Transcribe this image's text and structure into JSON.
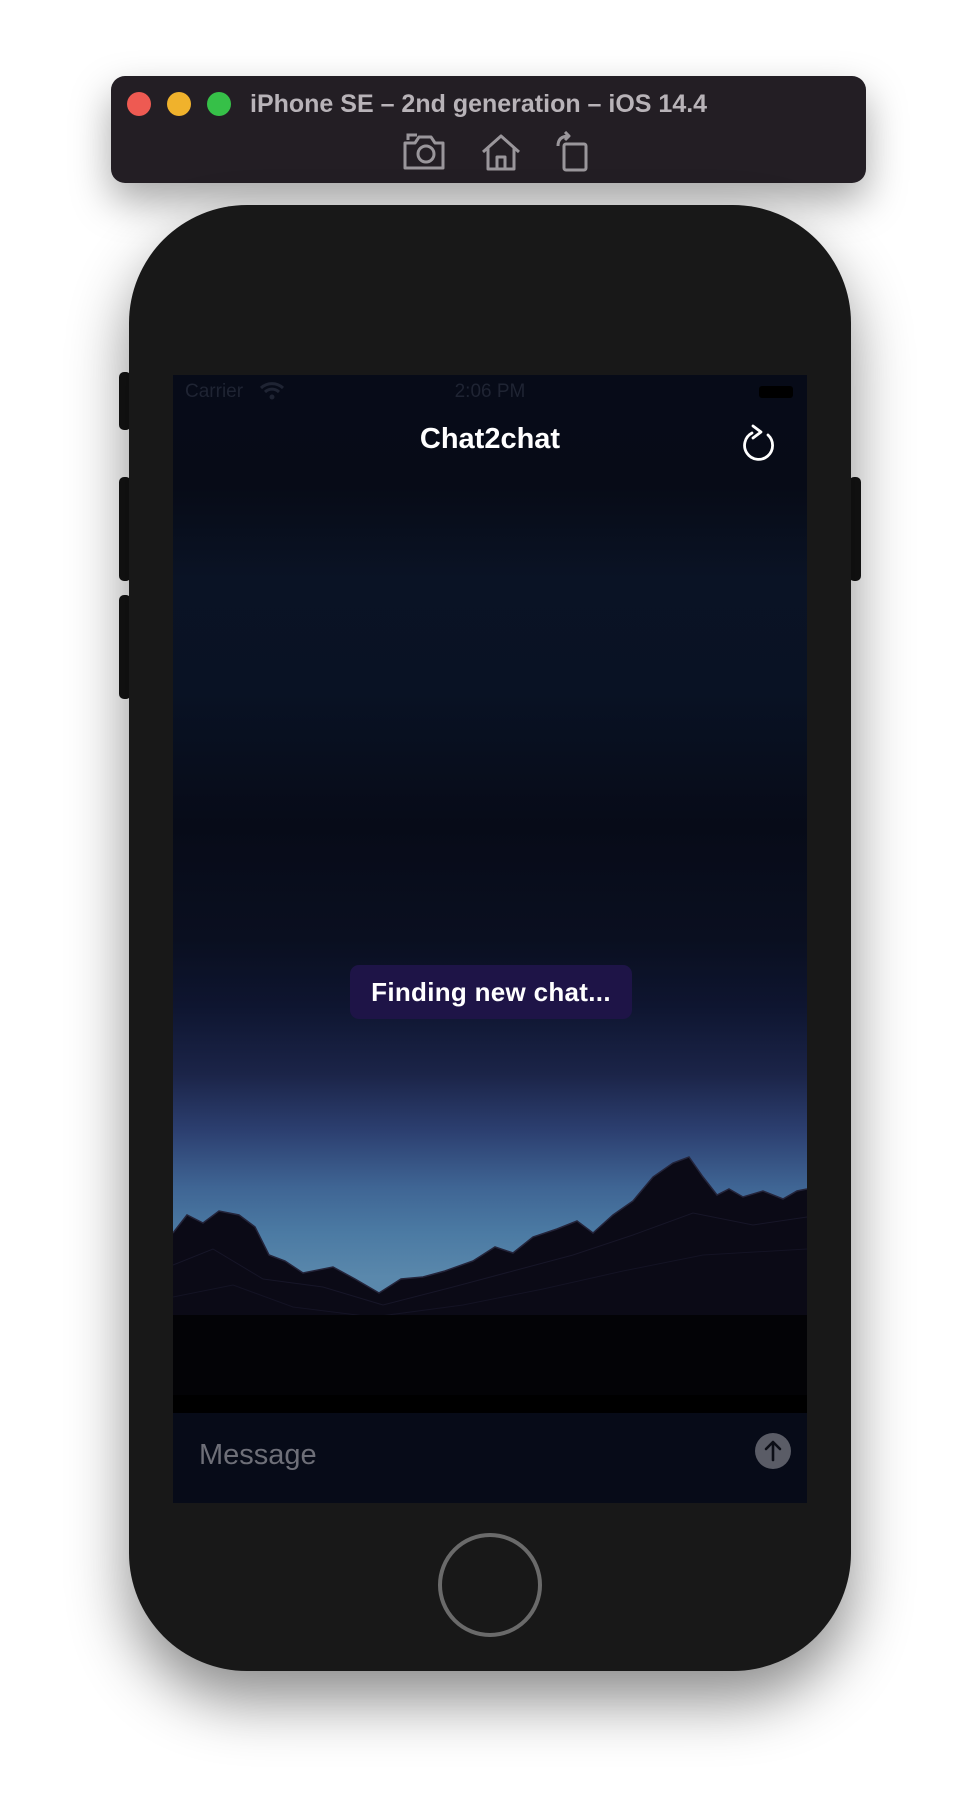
{
  "simulator": {
    "title": "iPhone SE – 2nd generation – iOS 14.4",
    "toolbar": [
      {
        "icon": "screenshot-icon"
      },
      {
        "icon": "home-icon"
      },
      {
        "icon": "rotate-icon"
      }
    ]
  },
  "status_bar": {
    "carrier": "Carrier",
    "time": "2:06 PM"
  },
  "nav": {
    "title": "Chat2chat",
    "refresh_icon": "refresh-icon"
  },
  "toast": {
    "text": "Finding new chat..."
  },
  "composer": {
    "placeholder": "Message",
    "send_icon": "arrow-up-icon"
  },
  "colors": {
    "nav_title": "#ffffff",
    "toast_background": "#1e1447",
    "send_button": "#5a5c66"
  }
}
